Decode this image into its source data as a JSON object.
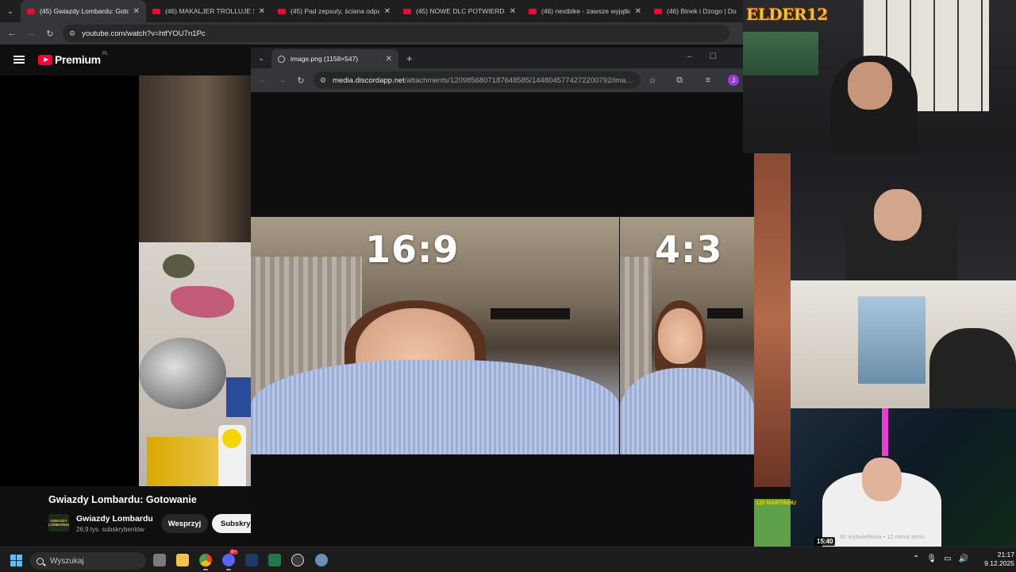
{
  "browser": {
    "tabs": [
      {
        "title": "(45) Gwiazdy Lombardu: Gotow",
        "active": true
      },
      {
        "title": "(46) MAKALJER TROLLUJE Spot",
        "active": false
      },
      {
        "title": "(45) Pad zepsuty, ściana odpad",
        "active": false
      },
      {
        "title": "(45) NOWE DLC POTWIERDZON",
        "active": false
      },
      {
        "title": "(46) nextbike - zawsze wyjątkow",
        "active": false
      },
      {
        "title": "(46) Binek i Dzogo | Domek",
        "active": false
      }
    ],
    "url": "youtube.com/watch?v=htfYOU7n1Pc"
  },
  "youtube": {
    "logo": "Premium",
    "region": "PL",
    "video_title": "Gwiazdy Lombardu: Gotowanie",
    "channel_name": "Gwiazdy Lombardu",
    "channel_subs": "26,9 tys. subskrybentów",
    "channel_avatar_text": [
      "GWIAZDY",
      "LOMBARDU"
    ],
    "support_button": "Wesprzyj",
    "subscribe_button": "Subskrybuj"
  },
  "popup": {
    "tab_title": "image.png (1158×547)",
    "url_domain": "media.discordapp.net",
    "url_path": "/attachments/1209856807187648585/1448045774272200792/image....",
    "profile_initial": "J",
    "image": {
      "left_label": "16:9",
      "right_label": "4:3"
    }
  },
  "overlay": {
    "logo_text": "ELDER",
    "logo_num": "12",
    "pepe_label": "120 MARTINHU",
    "yt_views": "92 wyświetlenia • 12 minut temu",
    "yt_time": "15:40"
  },
  "taskbar": {
    "search_placeholder": "Wyszukaj",
    "time": "21:17",
    "date": "9.12.2025",
    "discord_badge": "9+"
  },
  "colors": {
    "youtube_red": "#ff0033",
    "accent_blue": "#4cc2ff",
    "profile_purple": "#9b3ad8"
  }
}
